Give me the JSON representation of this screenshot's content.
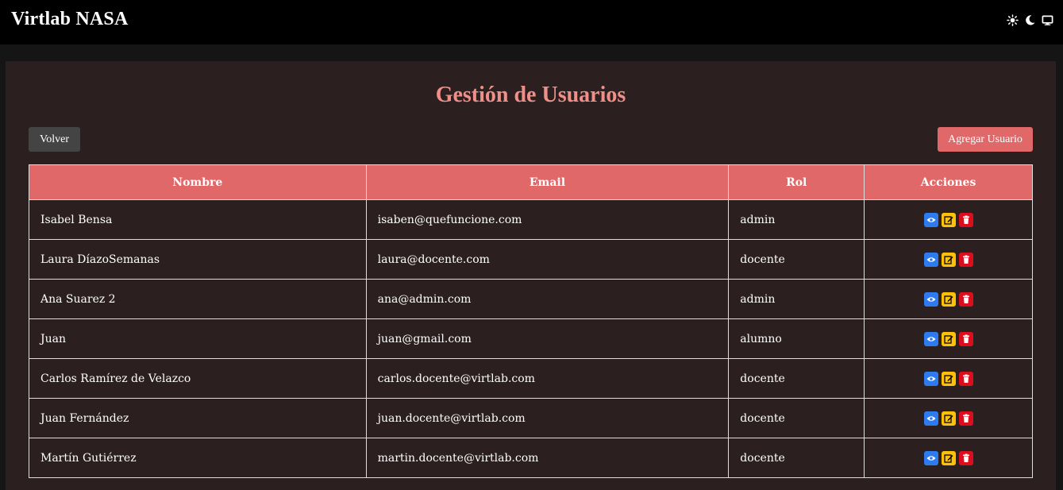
{
  "app": {
    "brand": "Virtlab NASA"
  },
  "theme_toggle": {
    "icons": [
      "sun-icon",
      "moon-icon",
      "monitor-icon"
    ]
  },
  "page": {
    "title": "Gestión de Usuarios",
    "back_label": "Volver",
    "add_label": "Agregar Usuario"
  },
  "table": {
    "headers": {
      "name": "Nombre",
      "email": "Email",
      "role": "Rol",
      "actions": "Acciones"
    },
    "rows": [
      {
        "name": "Isabel Bensa",
        "email": "isaben@quefuncione.com",
        "role": "admin"
      },
      {
        "name": "Laura DíazoSemanas",
        "email": "laura@docente.com",
        "role": "docente"
      },
      {
        "name": "Ana Suarez 2",
        "email": "ana@admin.com",
        "role": "admin"
      },
      {
        "name": "Juan",
        "email": "juan@gmail.com",
        "role": "alumno"
      },
      {
        "name": "Carlos Ramírez de Velazco",
        "email": "carlos.docente@virtlab.com",
        "role": "docente"
      },
      {
        "name": "Juan Fernández",
        "email": "juan.docente@virtlab.com",
        "role": "docente"
      },
      {
        "name": "Martín Gutiérrez",
        "email": "martin.docente@virtlab.com",
        "role": "docente"
      }
    ],
    "row_actions": [
      "eye-icon",
      "edit-icon",
      "trash-icon"
    ]
  },
  "colors": {
    "navbar": "#000000",
    "panel": "#2b1f20",
    "accent": "#e06868",
    "title": "#ef8f8a",
    "view": "#2e7bf0",
    "edit": "#ffc107",
    "delete": "#dc0e1e"
  }
}
